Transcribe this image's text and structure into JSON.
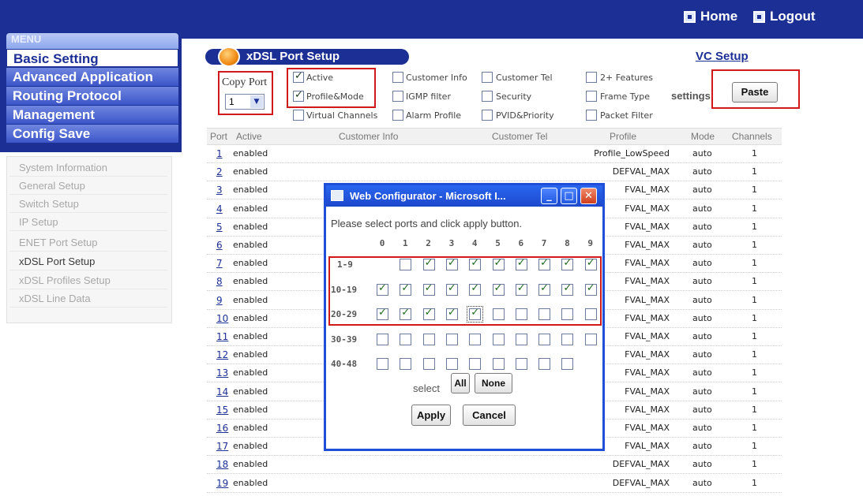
{
  "header": {
    "home_label": "Home",
    "logout_label": "Logout"
  },
  "menu": {
    "title": "MENU",
    "main_items": [
      {
        "label": "Basic Setting"
      },
      {
        "label": "Advanced Application"
      },
      {
        "label": "Routing Protocol"
      },
      {
        "label": "Management"
      },
      {
        "label": "Config Save"
      }
    ],
    "sub_items": [
      {
        "label": "System Information"
      },
      {
        "label": "General Setup"
      },
      {
        "label": "Switch Setup"
      },
      {
        "label": "IP Setup"
      },
      {
        "label": "ENET Port Setup"
      },
      {
        "label": "xDSL Port Setup"
      },
      {
        "label": "xDSL Profiles Setup"
      },
      {
        "label": "xDSL Line Data"
      }
    ]
  },
  "page": {
    "title": "xDSL Port Setup",
    "vc_setup_link": "VC Setup",
    "copy_port_label": "Copy Port",
    "copy_port_value": "1",
    "settings_label": "settings",
    "paste_label": "Paste",
    "options": [
      {
        "label": "Active",
        "checked": true
      },
      {
        "label": "Customer Info",
        "checked": false
      },
      {
        "label": "Customer Tel",
        "checked": false
      },
      {
        "label": "2+ Features",
        "checked": false
      },
      {
        "label": "Profile&Mode",
        "checked": true
      },
      {
        "label": "IGMP filter",
        "checked": false
      },
      {
        "label": "Security",
        "checked": false
      },
      {
        "label": "Frame Type",
        "checked": false
      },
      {
        "label": "Virtual Channels",
        "checked": false
      },
      {
        "label": "Alarm Profile",
        "checked": false
      },
      {
        "label": "PVID&Priority",
        "checked": false
      },
      {
        "label": "Packet Filter",
        "checked": false
      }
    ]
  },
  "table": {
    "headers": [
      "Port",
      "Active",
      "Customer Info",
      "Customer Tel",
      "Profile",
      "Mode",
      "Channels"
    ],
    "rows": [
      {
        "port": "1",
        "active": "enabled",
        "profile": "Profile_LowSpeed",
        "mode": "auto",
        "channels": "1"
      },
      {
        "port": "2",
        "active": "enabled",
        "profile": "DEFVAL_MAX",
        "mode": "auto",
        "channels": "1"
      },
      {
        "port": "3",
        "active": "enabled",
        "profile": "FVAL_MAX",
        "mode": "auto",
        "channels": "1"
      },
      {
        "port": "4",
        "active": "enabled",
        "profile": "FVAL_MAX",
        "mode": "auto",
        "channels": "1"
      },
      {
        "port": "5",
        "active": "enabled",
        "profile": "FVAL_MAX",
        "mode": "auto",
        "channels": "1"
      },
      {
        "port": "6",
        "active": "enabled",
        "profile": "FVAL_MAX",
        "mode": "auto",
        "channels": "1"
      },
      {
        "port": "7",
        "active": "enabled",
        "profile": "FVAL_MAX",
        "mode": "auto",
        "channels": "1"
      },
      {
        "port": "8",
        "active": "enabled",
        "profile": "FVAL_MAX",
        "mode": "auto",
        "channels": "1"
      },
      {
        "port": "9",
        "active": "enabled",
        "profile": "FVAL_MAX",
        "mode": "auto",
        "channels": "1"
      },
      {
        "port": "10",
        "active": "enabled",
        "profile": "FVAL_MAX",
        "mode": "auto",
        "channels": "1"
      },
      {
        "port": "11",
        "active": "enabled",
        "profile": "FVAL_MAX",
        "mode": "auto",
        "channels": "1"
      },
      {
        "port": "12",
        "active": "enabled",
        "profile": "FVAL_MAX",
        "mode": "auto",
        "channels": "1"
      },
      {
        "port": "13",
        "active": "enabled",
        "profile": "FVAL_MAX",
        "mode": "auto",
        "channels": "1"
      },
      {
        "port": "14",
        "active": "enabled",
        "profile": "FVAL_MAX",
        "mode": "auto",
        "channels": "1"
      },
      {
        "port": "15",
        "active": "enabled",
        "profile": "FVAL_MAX",
        "mode": "auto",
        "channels": "1"
      },
      {
        "port": "16",
        "active": "enabled",
        "profile": "FVAL_MAX",
        "mode": "auto",
        "channels": "1"
      },
      {
        "port": "17",
        "active": "enabled",
        "profile": "FVAL_MAX",
        "mode": "auto",
        "channels": "1"
      },
      {
        "port": "18",
        "active": "enabled",
        "profile": "DEFVAL_MAX",
        "mode": "auto",
        "channels": "1"
      },
      {
        "port": "19",
        "active": "enabled",
        "profile": "DEFVAL_MAX",
        "mode": "auto",
        "channels": "1"
      }
    ]
  },
  "dialog": {
    "title": "Web Configurator - Microsoft I...",
    "message": "Please select ports and click apply button.",
    "columns": [
      "0",
      "1",
      "2",
      "3",
      "4",
      "5",
      "6",
      "7",
      "8",
      "9"
    ],
    "rows": [
      {
        "label": "1-9",
        "checked": [
          null,
          false,
          true,
          true,
          true,
          true,
          true,
          true,
          true,
          true
        ]
      },
      {
        "label": "10-19",
        "checked": [
          true,
          true,
          true,
          true,
          true,
          true,
          true,
          true,
          true,
          true
        ]
      },
      {
        "label": "20-29",
        "checked": [
          true,
          true,
          true,
          true,
          true,
          false,
          false,
          false,
          false,
          false
        ]
      },
      {
        "label": "30-39",
        "checked": [
          false,
          false,
          false,
          false,
          false,
          false,
          false,
          false,
          false,
          false
        ]
      },
      {
        "label": "40-48",
        "checked": [
          false,
          false,
          false,
          false,
          false,
          false,
          false,
          false,
          false,
          null
        ]
      }
    ],
    "select_label": "select",
    "all_label": "All",
    "none_label": "None",
    "apply_label": "Apply",
    "cancel_label": "Cancel"
  },
  "colors": {
    "navy": "#1c2f95",
    "highlight_red": "#d01a1a",
    "dialog_blue": "#1f4fd8"
  }
}
